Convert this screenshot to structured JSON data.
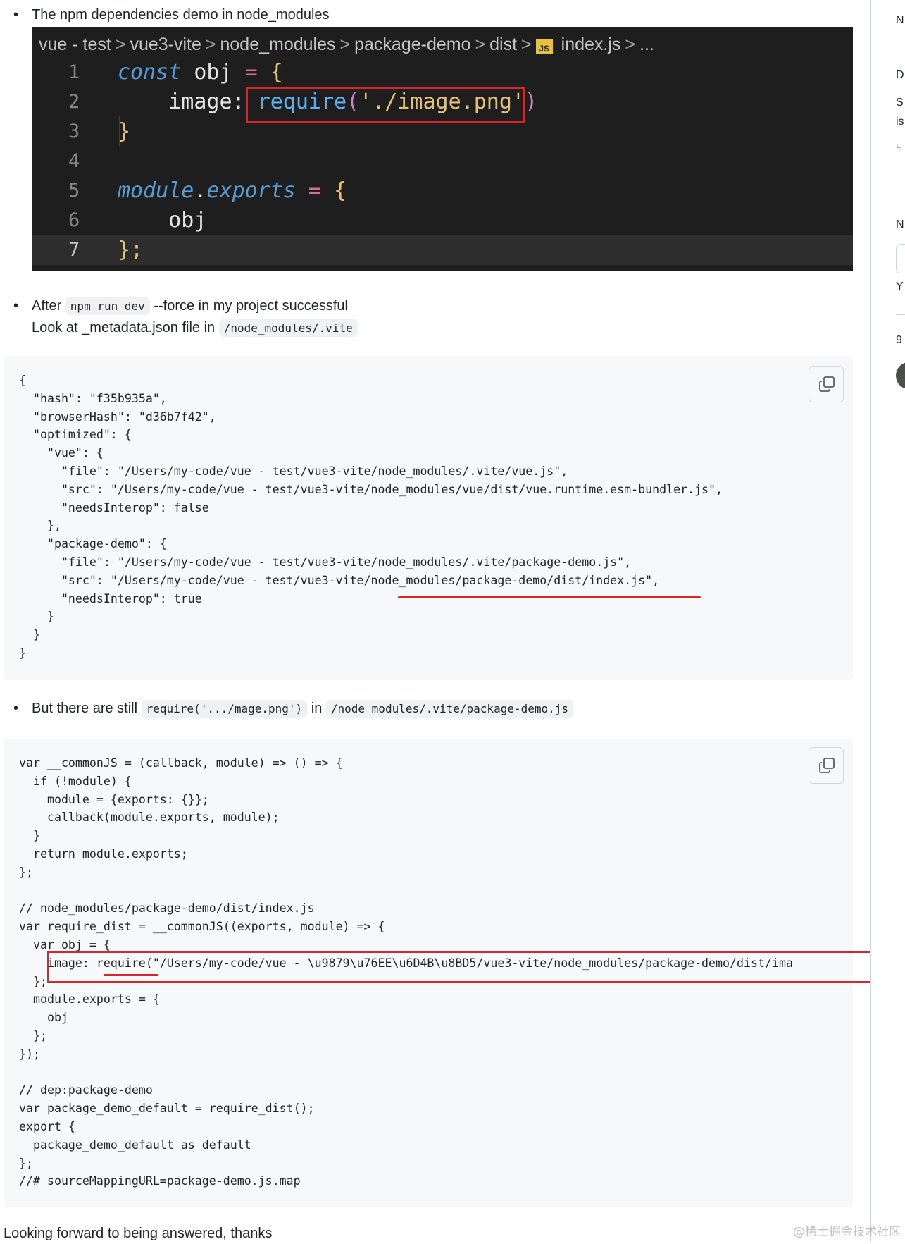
{
  "intro": {
    "bullet1": "The npm dependencies demo in node_modules"
  },
  "editor": {
    "breadcrumb": [
      "vue - test",
      "vue3-vite",
      "node_modules",
      "package-demo",
      "dist",
      "index.js",
      "..."
    ],
    "js_badge": "JS",
    "line_numbers": [
      "1",
      "2",
      "3",
      "4",
      "5",
      "6",
      "7"
    ],
    "lines": {
      "l1_kw": "const",
      "l1_ident": " obj ",
      "l1_op": "=",
      "l1_brace": " {",
      "l2_prop": "    image: ",
      "l2_fn": "require",
      "l2_paren_open": "(",
      "l2_str": "'./image.png'",
      "l2_paren_close": ")",
      "l3_brace": "}",
      "l5_mod": "module",
      "l5_dot": ".",
      "l5_exports": "exports",
      "l5_op": " = ",
      "l5_brace": "{",
      "l6_ident": "    obj",
      "l7_brace": "};"
    }
  },
  "after_run": {
    "prefix": "After ",
    "code": "npm run dev",
    "suffix": " --force in my project successful",
    "line2_prefix": "Look at _metadata.json file in ",
    "line2_code": "/node_modules/.vite"
  },
  "metadata_json": {
    "lines": [
      "{",
      "  \"hash\": \"f35b935a\",",
      "  \"browserHash\": \"d36b7f42\",",
      "  \"optimized\": {",
      "    \"vue\": {",
      "      \"file\": \"/Users/my-code/vue - test/vue3-vite/node_modules/.vite/vue.js\",",
      "      \"src\": \"/Users/my-code/vue - test/vue3-vite/node_modules/vue/dist/vue.runtime.esm-bundler.js\",",
      "      \"needsInterop\": false",
      "    },",
      "    \"package-demo\": {",
      "      \"file\": \"/Users/my-code/vue - test/vue3-vite/node_modules/.vite/package-demo.js\",",
      "      \"src\": \"/Users/my-code/vue - test/vue3-vite/node_modules/package-demo/dist/index.js\",",
      "      \"needsInterop\": true",
      "    }",
      "  }",
      "}"
    ]
  },
  "still": {
    "prefix": "But there are still ",
    "code1": "require('.../mage.png')",
    "middle": " in ",
    "code2": "/node_modules/.vite/package-demo.js"
  },
  "bundle_code": {
    "lines": [
      "var __commonJS = (callback, module) => () => {",
      "  if (!module) {",
      "    module = {exports: {}};",
      "    callback(module.exports, module);",
      "  }",
      "  return module.exports;",
      "};",
      "",
      "// node_modules/package-demo/dist/index.js",
      "var require_dist = __commonJS((exports, module) => {",
      "  var obj = {",
      "    image: require(\"/Users/my-code/vue - \\u9879\\u76EE\\u6D4B\\u8BD5/vue3-vite/node_modules/package-demo/dist/ima",
      "  };",
      "  module.exports = {",
      "    obj",
      "  };",
      "});",
      "",
      "// dep:package-demo",
      "var package_demo_default = require_dist();",
      "export {",
      "  package_demo_default as default",
      "};",
      "//# sourceMappingURL=package-demo.js.map"
    ]
  },
  "closing": "Looking forward to being answered, thanks",
  "watermark": "@稀土掘金技术社区",
  "rail": {
    "letters": [
      "N",
      "D",
      "S",
      "is",
      "N",
      "Y",
      "9"
    ]
  },
  "colors": {
    "highlight_red": "#d8272a",
    "editor_bg": "#1e1e1e",
    "code_bg": "#f6f8fa"
  },
  "icons": {
    "copy": "copy-icon",
    "file": "js-file-icon"
  }
}
